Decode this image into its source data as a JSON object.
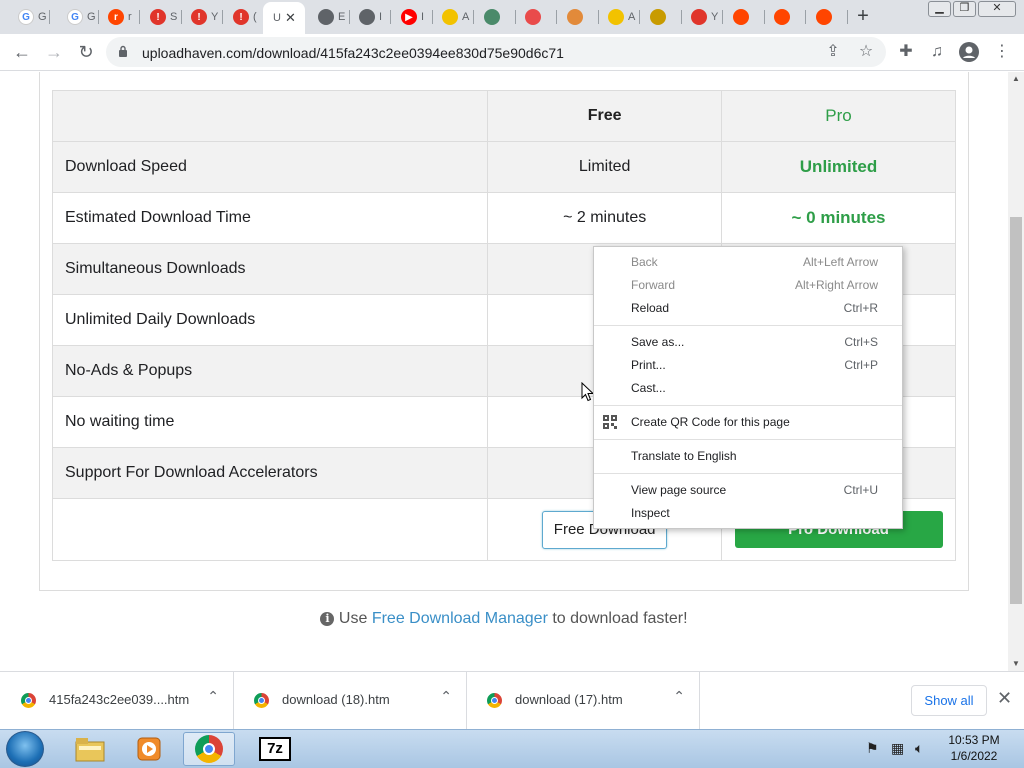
{
  "browser": {
    "tabs": [
      {
        "title": "G",
        "fav": "G",
        "color": "#4285f4",
        "bg": "#fff"
      },
      {
        "title": "G",
        "fav": "G",
        "color": "#4285f4",
        "bg": "#fff"
      },
      {
        "title": "r",
        "fav": "r",
        "color": "#fff",
        "bg": "#ff4500"
      },
      {
        "title": "S",
        "fav": "!",
        "color": "#fff",
        "bg": "#e0352b"
      },
      {
        "title": "Y",
        "fav": "!",
        "color": "#fff",
        "bg": "#e0352b"
      },
      {
        "title": "(",
        "fav": "!",
        "color": "#fff",
        "bg": "#e0352b"
      },
      {
        "title": "U",
        "fav": "",
        "color": "#fff",
        "bg": "#fff",
        "active": true
      },
      {
        "title": "E",
        "fav": "",
        "color": "#fff",
        "bg": "#5f6368"
      },
      {
        "title": "I",
        "fav": "",
        "color": "#fff",
        "bg": "#5f6368"
      },
      {
        "title": "I",
        "fav": "▶",
        "color": "#fff",
        "bg": "#ff0000"
      },
      {
        "title": "A",
        "fav": "",
        "color": "#333",
        "bg": "#f2c200"
      },
      {
        "title": "",
        "fav": "",
        "color": "#fff",
        "bg": "#4a8a6a"
      },
      {
        "title": "",
        "fav": "",
        "color": "#fff",
        "bg": "#e94b4b"
      },
      {
        "title": "",
        "fav": "",
        "color": "#fff",
        "bg": "#e28a3a"
      },
      {
        "title": "A",
        "fav": "",
        "color": "#333",
        "bg": "#f2c200"
      },
      {
        "title": "",
        "fav": "",
        "color": "#fff",
        "bg": "#c89b00"
      },
      {
        "title": "Y",
        "fav": "",
        "color": "#fff",
        "bg": "#e0352b"
      },
      {
        "title": "",
        "fav": "",
        "color": "#fff",
        "bg": "#ff4500"
      },
      {
        "title": "",
        "fav": "",
        "color": "#fff",
        "bg": "#ff4500"
      },
      {
        "title": "",
        "fav": "",
        "color": "#fff",
        "bg": "#ff4500"
      }
    ],
    "active_tab_title": "U",
    "new_tab": "+",
    "url": "uploadhaven.com/download/415fa243c2ee0394ee830d75e90d6c71"
  },
  "compare": {
    "header_free": "Free",
    "header_pro": "Pro",
    "rows": [
      {
        "feature": "Download Speed",
        "free": "Limited",
        "pro": "Unlimited",
        "shade": true
      },
      {
        "feature": "Estimated Download Time",
        "free": "~ 2 minutes",
        "pro": "~ 0 minutes",
        "shade": false
      },
      {
        "feature": "Simultaneous Downloads",
        "free": "",
        "pro": "",
        "shade": true
      },
      {
        "feature": "Unlimited Daily Downloads",
        "free": "",
        "pro": "",
        "shade": false
      },
      {
        "feature": "No-Ads & Popups",
        "free": "",
        "pro": "",
        "shade": true
      },
      {
        "feature": "No waiting time",
        "free": "",
        "pro": "",
        "shade": false
      },
      {
        "feature": "Support For Download Accelerators",
        "free": "",
        "pro": "",
        "shade": true
      }
    ],
    "free_button": "Free Download",
    "pro_button": "Pro Download"
  },
  "tip": {
    "prefix": "Use ",
    "link": "Free Download Manager",
    "suffix": " to download faster!"
  },
  "context_menu": {
    "groups": [
      [
        {
          "label": "Back",
          "shortcut": "Alt+Left Arrow",
          "disabled": true,
          "ul": "B"
        },
        {
          "label": "Forward",
          "shortcut": "Alt+Right Arrow",
          "disabled": true,
          "ul": "F"
        },
        {
          "label": "Reload",
          "shortcut": "Ctrl+R",
          "disabled": false,
          "ul": "R"
        }
      ],
      [
        {
          "label": "Save as...",
          "shortcut": "Ctrl+S",
          "disabled": false,
          "ul": "a"
        },
        {
          "label": "Print...",
          "shortcut": "Ctrl+P",
          "disabled": false,
          "ul": "P"
        },
        {
          "label": "Cast...",
          "shortcut": "",
          "disabled": false,
          "ul": "C"
        }
      ],
      [
        {
          "label": "Create QR Code for this page",
          "shortcut": "",
          "disabled": false,
          "icon": "qr-code-icon"
        }
      ],
      [
        {
          "label": "Translate to English",
          "shortcut": "",
          "disabled": false,
          "ul": "T"
        }
      ],
      [
        {
          "label": "View page source",
          "shortcut": "Ctrl+U",
          "disabled": false,
          "ul": "V"
        },
        {
          "label": "Inspect",
          "shortcut": "",
          "disabled": false,
          "ul": "I"
        }
      ]
    ]
  },
  "downloads": {
    "items": [
      {
        "name": "415fa243c2ee039....htm"
      },
      {
        "name": "download (18).htm"
      },
      {
        "name": "download (17).htm"
      }
    ],
    "show_all": "Show all"
  },
  "taskbar": {
    "time": "10:53 PM",
    "date": "1/6/2022"
  }
}
